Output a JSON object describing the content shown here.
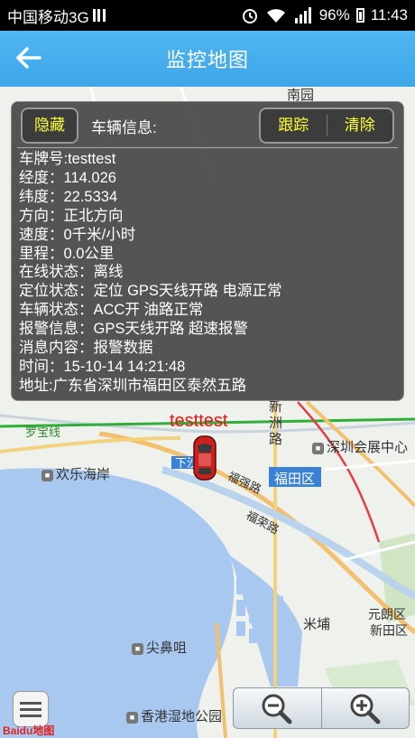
{
  "status_bar": {
    "carrier": "中国移动3G",
    "network": "3G",
    "battery": "96%",
    "time": "11:43"
  },
  "header": {
    "title": "监控地图",
    "back_icon": "arrow-left-icon"
  },
  "panel": {
    "hide_button": "隐藏",
    "vehicle_info_label": "车辆信息:",
    "track_button": "跟踪",
    "clear_button": "清除",
    "lines": [
      "车牌号:testtest",
      "经度：114.026",
      "纬度：22.5334",
      "方向：正北方向",
      "速度：0千米/小时",
      "里程：0.0公里",
      "在线状态：离线",
      "定位状态：定位 GPS天线开路 电源正常",
      "车辆状态：ACC开 油路正常",
      "报警信息：GPS天线开路 超速报警",
      "消息内容：报警数据",
      "时间：15-10-14 14:21:48",
      "地址:广东省深圳市福田区泰然五路"
    ]
  },
  "map": {
    "labels": {
      "nanyuan": "南园",
      "luobaoxian": "罗宝线",
      "huanlehaian": "欢乐海岸",
      "xinzhoulu": "新洲路",
      "shenzhenhuizhan": "深圳会展中心",
      "futianqu": "福田区",
      "fuqianglu": "福强路",
      "fuhualu": "福荣路",
      "xiasha": "下沙",
      "mibu": "米埔",
      "yuanlang": "元朗区",
      "xintianqu": "新田区",
      "jianweizui": "尖鼻咀",
      "xianggangshidi": "香港湿地公园"
    },
    "car_label": "testtest"
  },
  "controls": {
    "list_icon": "list-icon",
    "zoom_out_icon": "zoom-out-icon",
    "zoom_in_icon": "zoom-in-icon",
    "baidu_logo": "Baidu地图"
  }
}
